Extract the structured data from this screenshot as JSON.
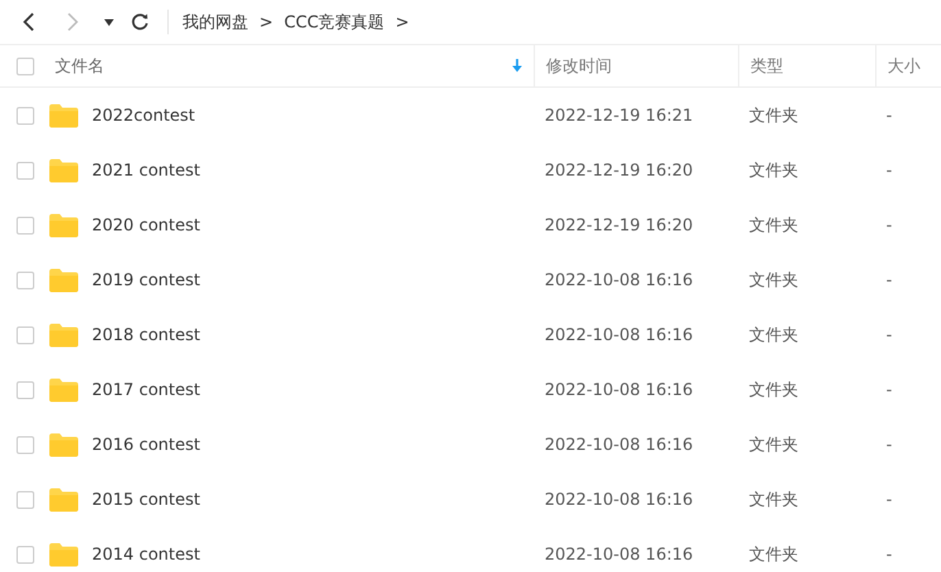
{
  "toolbar": {
    "breadcrumb": [
      "我的网盘",
      "CCC竞赛真题"
    ],
    "separator": ">"
  },
  "table": {
    "columns": [
      {
        "label": "文件名",
        "sorted": true
      },
      {
        "label": "修改时间",
        "sorted": false
      },
      {
        "label": "类型",
        "sorted": false
      },
      {
        "label": "大小",
        "sorted": false
      }
    ],
    "select_all_checked": false,
    "rows": [
      {
        "name": "2022contest",
        "modified": "2022-12-19 16:21",
        "type": "文件夹",
        "size": "-",
        "checked": false
      },
      {
        "name": "2021 contest",
        "modified": "2022-12-19 16:20",
        "type": "文件夹",
        "size": "-",
        "checked": false
      },
      {
        "name": "2020 contest",
        "modified": "2022-12-19 16:20",
        "type": "文件夹",
        "size": "-",
        "checked": false
      },
      {
        "name": "2019 contest",
        "modified": "2022-10-08 16:16",
        "type": "文件夹",
        "size": "-",
        "checked": false
      },
      {
        "name": "2018 contest",
        "modified": "2022-10-08 16:16",
        "type": "文件夹",
        "size": "-",
        "checked": false
      },
      {
        "name": "2017 contest",
        "modified": "2022-10-08 16:16",
        "type": "文件夹",
        "size": "-",
        "checked": false
      },
      {
        "name": "2016 contest",
        "modified": "2022-10-08 16:16",
        "type": "文件夹",
        "size": "-",
        "checked": false
      },
      {
        "name": "2015 contest",
        "modified": "2022-10-08 16:16",
        "type": "文件夹",
        "size": "-",
        "checked": false
      },
      {
        "name": "2014 contest",
        "modified": "2022-10-08 16:16",
        "type": "文件夹",
        "size": "-",
        "checked": false
      }
    ]
  }
}
